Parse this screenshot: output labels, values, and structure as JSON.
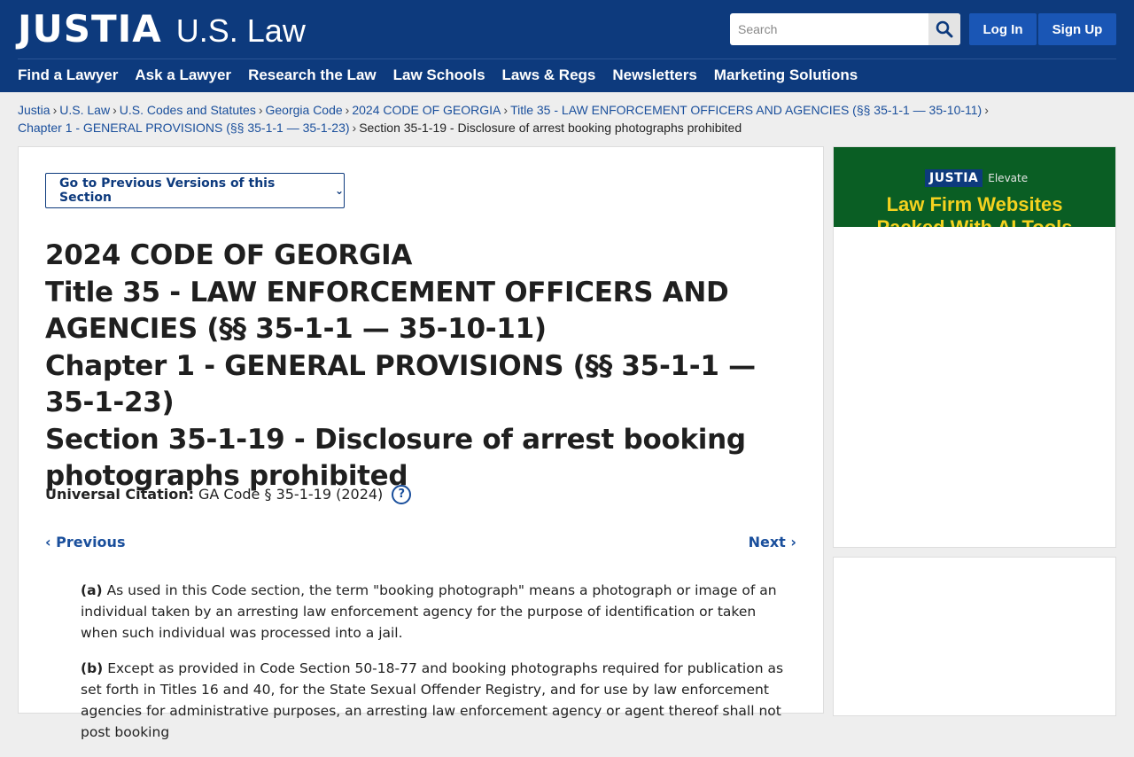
{
  "header": {
    "logo": "JUSTIA",
    "logo_sub": "U.S. Law",
    "search_placeholder": "Search",
    "login": "Log In",
    "signup": "Sign Up",
    "nav": [
      "Find a Lawyer",
      "Ask a Lawyer",
      "Research the Law",
      "Law Schools",
      "Laws & Regs",
      "Newsletters",
      "Marketing Solutions"
    ]
  },
  "breadcrumb": [
    "Justia",
    "U.S. Law",
    "U.S. Codes and Statutes",
    "Georgia Code",
    "2024 CODE OF GEORGIA",
    "Title 35 - LAW ENFORCEMENT OFFICERS AND AGENCIES (§§ 35-1-1 — 35-10-11)",
    "Chapter 1 - GENERAL PROVISIONS (§§ 35-1-1 — 35-1-23)",
    "Section 35-1-19 - Disclosure of arrest booking photographs prohibited"
  ],
  "main": {
    "prev_versions": "Go to Previous Versions of this Section",
    "heading": [
      "2024 CODE OF GEORGIA",
      "Title 35 - LAW ENFORCEMENT OFFICERS AND AGENCIES (§§ 35-1-1 — 35-10-11)",
      "Chapter 1 - GENERAL PROVISIONS (§§ 35-1-1 — 35-1-23)",
      "Section 35-1-19 - Disclosure of arrest booking photographs prohibited"
    ],
    "citation_label": "Universal Citation:",
    "citation_value": "GA Code § 35-1-19 (2024)",
    "help": "?",
    "previous": "Previous",
    "next": "Next",
    "paragraphs": [
      {
        "label": "(a)",
        "text": "As used in this Code section, the term \"booking photograph\" means a photograph or image of an individual taken by an arresting law enforcement agency for the purpose of identification or taken when such individual was processed into a jail."
      },
      {
        "label": "(b)",
        "text": "Except as provided in Code Section 50-18-77 and booking photographs required for publication as set forth in Titles 16 and 40, for the State Sexual Offender Registry, and for use by law enforcement agencies for administrative purposes, an arresting law enforcement agency or agent thereof shall not post booking"
      }
    ]
  },
  "ad": {
    "brand": "JUSTIA",
    "brand_sub": "Elevate",
    "line1": "Law Firm Websites",
    "line2": "Packed With AI Tools"
  }
}
